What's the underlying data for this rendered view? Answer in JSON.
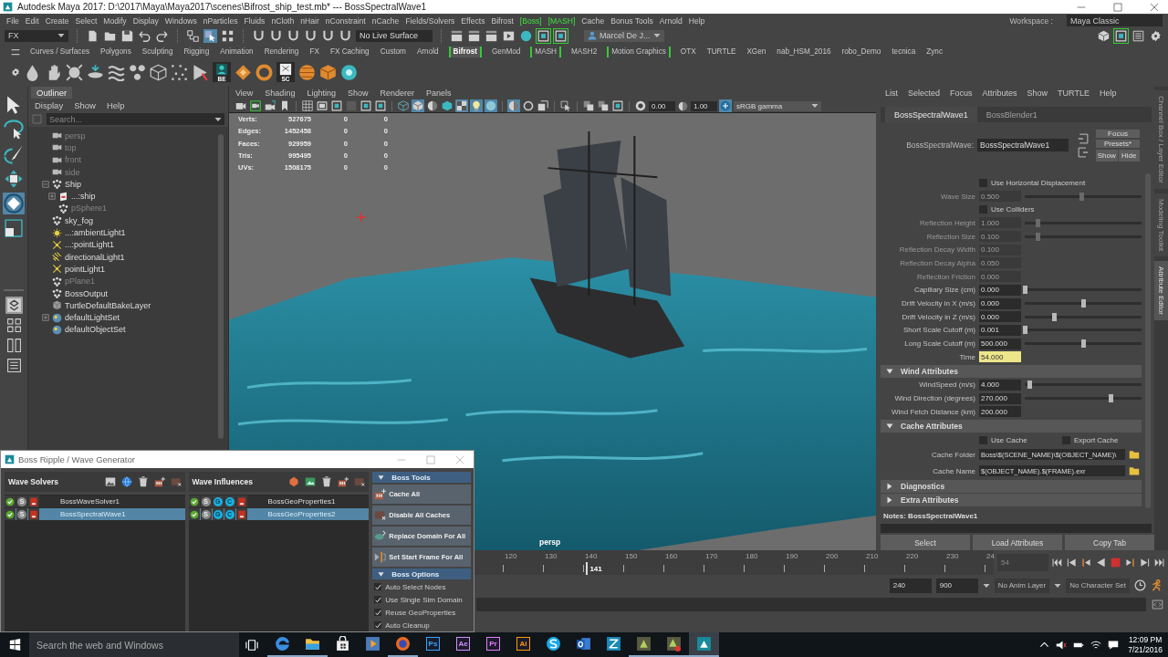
{
  "window": {
    "title": "Autodesk Maya 2017: D:\\2017\\Maya\\Maya2017\\scenes\\Bifrost_ship_test.mb* --- BossSpectralWave1"
  },
  "menu_bar": {
    "items": [
      {
        "label": "File",
        "highlighted": false
      },
      {
        "label": "Edit",
        "highlighted": false
      },
      {
        "label": "Create",
        "highlighted": false
      },
      {
        "label": "Select",
        "highlighted": false
      },
      {
        "label": "Modify",
        "highlighted": false
      },
      {
        "label": "Display",
        "highlighted": false
      },
      {
        "label": "Windows",
        "highlighted": false
      },
      {
        "label": "nParticles",
        "highlighted": false
      },
      {
        "label": "Fluids",
        "highlighted": false
      },
      {
        "label": "nCloth",
        "highlighted": false
      },
      {
        "label": "nHair",
        "highlighted": false
      },
      {
        "label": "nConstraint",
        "highlighted": false
      },
      {
        "label": "nCache",
        "highlighted": false
      },
      {
        "label": "Fields/Solvers",
        "highlighted": false
      },
      {
        "label": "Effects",
        "highlighted": false
      },
      {
        "label": "Bifrost",
        "highlighted": false
      },
      {
        "label": "[Boss]",
        "highlighted": true
      },
      {
        "label": "[MASH]",
        "highlighted": true
      },
      {
        "label": "Cache",
        "highlighted": false
      },
      {
        "label": "Bonus Tools",
        "highlighted": false
      },
      {
        "label": "Arnold",
        "highlighted": false
      },
      {
        "label": "Help",
        "highlighted": false
      }
    ],
    "workspace_label": "Workspace :",
    "workspace": "Maya Classic"
  },
  "status_line": {
    "menu_set": "FX",
    "file_tools": [
      {
        "kind": "doc",
        "on": false
      },
      {
        "kind": "folder",
        "on": false
      },
      {
        "kind": "save",
        "on": false
      },
      {
        "kind": "undo",
        "on": false
      },
      {
        "kind": "redo",
        "on": false
      }
    ],
    "select_modes": [
      {
        "kind": "select-hier",
        "on": false
      },
      {
        "kind": "select-obj",
        "on": true
      },
      {
        "kind": "select-comp",
        "on": false
      }
    ],
    "snaps": [
      {
        "kind": "magnet",
        "on": false
      },
      {
        "kind": "magnet",
        "on": false
      },
      {
        "kind": "magnet",
        "on": false
      },
      {
        "kind": "magnet",
        "on": false
      },
      {
        "kind": "magnet",
        "on": false
      },
      {
        "kind": "magnet",
        "on": false
      }
    ],
    "live_surface": "No Live Surface",
    "render_tools": [
      {
        "kind": "clapper",
        "on": false
      },
      {
        "kind": "clapper",
        "on": false
      },
      {
        "kind": "clapper",
        "on": false
      },
      {
        "kind": "render",
        "on": false
      },
      {
        "kind": "sphere-teal",
        "on": false
      },
      {
        "kind": "frame",
        "on": true
      },
      {
        "kind": "frame",
        "on": true
      }
    ],
    "user": "Marcel De J...",
    "panel_toggles": [
      {
        "kind": "cube",
        "on": false
      },
      {
        "kind": "frame",
        "on": true
      },
      {
        "kind": "layout-list",
        "on": false
      },
      {
        "kind": "gear",
        "on": false
      }
    ]
  },
  "shelf": {
    "tabs": [
      {
        "label": "Curves / Surfaces",
        "selected": false,
        "bracketed": false
      },
      {
        "label": "Polygons",
        "selected": false,
        "bracketed": false
      },
      {
        "label": "Sculpting",
        "selected": false,
        "bracketed": false
      },
      {
        "label": "Rigging",
        "selected": false,
        "bracketed": false
      },
      {
        "label": "Animation",
        "selected": false,
        "bracketed": false
      },
      {
        "label": "Rendering",
        "selected": false,
        "bracketed": false
      },
      {
        "label": "FX",
        "selected": false,
        "bracketed": false
      },
      {
        "label": "FX Caching",
        "selected": false,
        "bracketed": false
      },
      {
        "label": "Custom",
        "selected": false,
        "bracketed": false
      },
      {
        "label": "Arnold",
        "selected": false,
        "bracketed": false
      },
      {
        "label": "Bifrost",
        "selected": true,
        "bracketed": true
      },
      {
        "label": "GenMod",
        "selected": false,
        "bracketed": false
      },
      {
        "label": "MASH",
        "selected": false,
        "bracketed": true
      },
      {
        "label": "MASH2",
        "selected": false,
        "bracketed": false
      },
      {
        "label": "Motion Graphics",
        "selected": false,
        "bracketed": true
      },
      {
        "label": "OTX",
        "selected": false,
        "bracketed": false
      },
      {
        "label": "TURTLE",
        "selected": false,
        "bracketed": false
      },
      {
        "label": "XGen",
        "selected": false,
        "bracketed": false
      },
      {
        "label": "nab_HSM_2016",
        "selected": false,
        "bracketed": false
      },
      {
        "label": "robo_Demo",
        "selected": false,
        "bracketed": false
      },
      {
        "label": "tecnica",
        "selected": false,
        "bracketed": false
      },
      {
        "label": "Zync",
        "selected": false,
        "bracketed": false
      }
    ],
    "buttons": [
      {
        "kind": "droplet"
      },
      {
        "kind": "hand"
      },
      {
        "kind": "splash"
      },
      {
        "kind": "ripple"
      },
      {
        "kind": "waves"
      },
      {
        "kind": "cluster"
      },
      {
        "kind": "cube-wire"
      },
      {
        "kind": "scatter"
      },
      {
        "kind": "play-pointer"
      },
      {
        "kind": "rig-tile",
        "caption": "BE"
      },
      {
        "kind": "diamond"
      },
      {
        "kind": "orange-ring"
      },
      {
        "kind": "card",
        "caption": "SC"
      },
      {
        "kind": "striped-sphere"
      },
      {
        "kind": "orange-cube"
      },
      {
        "kind": "teal-dot"
      }
    ]
  },
  "toolbox": {
    "tools": [
      {
        "kind": "arrow",
        "selected": false
      },
      {
        "kind": "lasso",
        "selected": false
      },
      {
        "kind": "paint",
        "selected": false
      },
      {
        "kind": "move",
        "selected": false
      },
      {
        "kind": "rotate",
        "selected": true
      },
      {
        "kind": "scale",
        "selected": false
      }
    ],
    "layouts": [
      {
        "kind": "layout-single",
        "selected": true
      },
      {
        "kind": "layout-four",
        "selected": false
      },
      {
        "kind": "layout-two",
        "selected": false
      },
      {
        "kind": "layout-outliner",
        "selected": false
      }
    ]
  },
  "outliner": {
    "title": "Outliner",
    "menu": [
      "Display",
      "Show",
      "Help"
    ],
    "search_placeholder": "Search...",
    "items": [
      {
        "label": "persp",
        "kind": "camera",
        "hidden": true
      },
      {
        "label": "top",
        "kind": "camera",
        "hidden": true
      },
      {
        "label": "front",
        "kind": "camera",
        "hidden": true
      },
      {
        "label": "side",
        "kind": "camera",
        "hidden": true
      },
      {
        "label": "Ship",
        "kind": "mesh",
        "hidden": false,
        "expanded": true,
        "children": [
          {
            "label": "...:ship",
            "kind": "reference",
            "hidden": false,
            "expanded": false
          },
          {
            "label": "pSphere1",
            "kind": "mesh",
            "hidden": true
          }
        ]
      },
      {
        "label": "sky_fog",
        "kind": "mesh",
        "hidden": false
      },
      {
        "label": "...:ambientLight1",
        "kind": "ambient-light",
        "hidden": false
      },
      {
        "label": "...:pointLight1",
        "kind": "point-light",
        "hidden": false
      },
      {
        "label": "directionalLight1",
        "kind": "directional-light",
        "hidden": false
      },
      {
        "label": "pointLight1",
        "kind": "point-light",
        "hidden": false
      },
      {
        "label": "pPlane1",
        "kind": "mesh",
        "hidden": true
      },
      {
        "label": "BossOutput",
        "kind": "mesh",
        "hidden": false
      },
      {
        "label": "TurtleDefaultBakeLayer",
        "kind": "bake-layer",
        "hidden": false
      },
      {
        "label": "defaultLightSet",
        "kind": "set",
        "hidden": false,
        "expanded": false
      },
      {
        "label": "defaultObjectSet",
        "kind": "set",
        "hidden": false
      }
    ]
  },
  "viewport": {
    "menu": [
      "View",
      "Shading",
      "Lighting",
      "Show",
      "Renderer",
      "Panels"
    ],
    "toolbar": [
      {
        "kind": "camera",
        "on": false
      },
      {
        "kind": "camera-green",
        "on": false
      },
      {
        "kind": "camera-move",
        "on": false
      },
      {
        "kind": "bookmark",
        "on": false
      },
      {
        "kind": "separator"
      },
      {
        "kind": "grid",
        "on": false
      },
      {
        "kind": "film",
        "on": false
      },
      {
        "kind": "frame",
        "on": false
      },
      {
        "kind": "square",
        "on": false
      },
      {
        "kind": "frame",
        "on": false
      },
      {
        "kind": "frame",
        "on": false
      },
      {
        "kind": "separator"
      },
      {
        "kind": "cube-wire-blue",
        "on": false
      },
      {
        "kind": "cube",
        "on": true
      },
      {
        "kind": "halfmoon",
        "on": false
      },
      {
        "kind": "cube-teal",
        "on": false
      },
      {
        "kind": "checker",
        "on": true
      },
      {
        "kind": "bulb",
        "on": true
      },
      {
        "kind": "sphere",
        "on": true
      },
      {
        "kind": "separator"
      },
      {
        "kind": "shadow",
        "on": true
      },
      {
        "kind": "ring-grey",
        "on": false
      },
      {
        "kind": "cube-small",
        "on": false
      },
      {
        "kind": "separator"
      },
      {
        "kind": "pointer-box",
        "on": false
      },
      {
        "kind": "separator"
      },
      {
        "kind": "xray",
        "on": false
      },
      {
        "kind": "xray",
        "on": false
      },
      {
        "kind": "frame",
        "on": false
      },
      {
        "kind": "separator"
      },
      {
        "kind": "aperture",
        "on": false
      }
    ],
    "exposure": "0.00",
    "gamma": "1.00",
    "color_space": "sRGB gamma",
    "stats": [
      {
        "label": "Verts:",
        "values": [
          "527675",
          "0",
          "0"
        ]
      },
      {
        "label": "Edges:",
        "values": [
          "1452458",
          "0",
          "0"
        ]
      },
      {
        "label": "Faces:",
        "values": [
          "929959",
          "0",
          "0"
        ]
      },
      {
        "label": "Tris:",
        "values": [
          "995495",
          "0",
          "0"
        ]
      },
      {
        "label": "UVs:",
        "values": [
          "1508175",
          "0",
          "0"
        ]
      }
    ],
    "camera": "persp"
  },
  "attribute_editor": {
    "menu": [
      "List",
      "Selected",
      "Focus",
      "Attributes",
      "Show",
      "TURTLE",
      "Help"
    ],
    "tabs": [
      {
        "label": "BossSpectralWave1",
        "selected": true
      },
      {
        "label": "BossBlender1",
        "selected": false
      }
    ],
    "node_label": "BossSpectralWave:",
    "node_name": "BossSpectralWave1",
    "side_buttons": [
      "Focus",
      "Presets*"
    ],
    "show_hide": [
      "Show",
      "Hide"
    ],
    "rows": [
      {
        "kind": "checkbox",
        "label": "Use Horizontal Displacement",
        "checked": false
      },
      {
        "kind": "slider",
        "label": "Wave Size",
        "value": "0.500",
        "level": 0.49,
        "disabled": true,
        "keyed": false
      },
      {
        "kind": "checkbox",
        "label": "Use Colliders",
        "checked": false
      },
      {
        "kind": "slider",
        "label": "Reflection Height",
        "value": "1.000",
        "level": 0.11,
        "disabled": true,
        "keyed": false
      },
      {
        "kind": "slider",
        "label": "Reflection Size",
        "value": "0.100",
        "level": 0.11,
        "disabled": true,
        "keyed": false
      },
      {
        "kind": "field",
        "label": "Reflection Decay Width",
        "value": "0.100",
        "disabled": true,
        "keyed": false
      },
      {
        "kind": "field",
        "label": "Reflection Decay Alpha",
        "value": "0.050",
        "disabled": true,
        "keyed": false
      },
      {
        "kind": "field",
        "label": "Reflection Friction",
        "value": "0.000",
        "disabled": true,
        "keyed": false
      },
      {
        "kind": "slider",
        "label": "Capillary Size (cm)",
        "value": "0.000",
        "level": 0,
        "disabled": false,
        "keyed": false
      },
      {
        "kind": "slider",
        "label": "Drift Velocity in X (m/s)",
        "value": "0.000",
        "level": 0.5,
        "disabled": false,
        "keyed": false
      },
      {
        "kind": "slider",
        "label": "Drift Velocity in Z (m/s)",
        "value": "0.000",
        "level": 0.25,
        "disabled": false,
        "keyed": false
      },
      {
        "kind": "slider",
        "label": "Short Scale Cutoff (m)",
        "value": "0.001",
        "level": 0,
        "disabled": false,
        "keyed": false
      },
      {
        "kind": "slider",
        "label": "Long Scale Cutoff (m)",
        "value": "500.000",
        "level": 0.5,
        "disabled": false,
        "keyed": false
      },
      {
        "kind": "field",
        "label": "Time",
        "value": "54.000",
        "disabled": false,
        "keyed": true
      },
      {
        "kind": "section",
        "label": "Wind Attributes",
        "expanded": true
      },
      {
        "kind": "slider",
        "label": "WindSpeed (m/s)",
        "value": "4.000",
        "level": 0.04,
        "disabled": false,
        "keyed": false
      },
      {
        "kind": "slider",
        "label": "Wind Direction (degrees)",
        "value": "270.000",
        "level": 0.74,
        "disabled": false,
        "keyed": false
      },
      {
        "kind": "field",
        "label": "Wind Fetch Distance (km)",
        "value": "200.000",
        "disabled": false,
        "keyed": false
      },
      {
        "kind": "section",
        "label": "Cache Attributes",
        "expanded": true
      },
      {
        "kind": "checkbox-pair",
        "items": [
          {
            "label": "Use Cache",
            "checked": false
          },
          {
            "label": "Export Cache",
            "checked": false
          }
        ]
      },
      {
        "kind": "path",
        "label": "Cache Folder",
        "value": "Boss\\$(SCENE_NAME)\\$(OBJECT_NAME)\\"
      },
      {
        "kind": "path",
        "label": "Cache Name",
        "value": "$(OBJECT_NAME).$(FRAME).exr"
      },
      {
        "kind": "section",
        "label": "Diagnostics",
        "expanded": false
      },
      {
        "kind": "section",
        "label": "Extra Attributes",
        "expanded": false
      }
    ],
    "notes": "Notes: BossSpectralWave1",
    "buttons": [
      "Select",
      "Load Attributes",
      "Copy Tab"
    ]
  },
  "side_tabs": [
    {
      "label": "Channel Box / Layer Editor",
      "selected": false
    },
    {
      "label": "Modeling Toolkit",
      "selected": false
    },
    {
      "label": "Attribute Editor",
      "selected": true
    }
  ],
  "timeline": {
    "ticks": [
      "120",
      "130",
      "140",
      "150",
      "160",
      "170",
      "180",
      "190",
      "200",
      "210",
      "220",
      "230",
      "24"
    ],
    "playhead": {
      "label": "141",
      "level": 0.175
    },
    "current_time": "54"
  },
  "range_bar": {
    "playback_end": "240",
    "animation_end": "900",
    "anim_layer": "No Anim Layer",
    "character_set": "No Character Set"
  },
  "boss_window": {
    "title": "Boss Ripple / Wave Generator",
    "solvers": {
      "title": "Wave Solvers",
      "rows": [
        {
          "name": "BossWaveSolver1",
          "selected": false,
          "enabled": true,
          "badges": [
            {
              "label": "S",
              "active": false
            }
          ]
        },
        {
          "name": "BossSpectralWave1",
          "selected": true,
          "enabled": true,
          "badges": [
            {
              "label": "S",
              "active": false
            }
          ]
        }
      ]
    },
    "influences": {
      "title": "Wave Influences",
      "rows": [
        {
          "name": "BossGeoProperties1",
          "selected": false,
          "enabled": true,
          "badges": [
            {
              "label": "S",
              "active": false
            },
            {
              "label": "G",
              "active": true
            },
            {
              "label": "C",
              "active": true
            }
          ]
        },
        {
          "name": "BossGeoProperties2",
          "selected": true,
          "enabled": true,
          "badges": [
            {
              "label": "S",
              "active": false
            },
            {
              "label": "G",
              "active": true
            },
            {
              "label": "C",
              "active": true
            }
          ]
        }
      ]
    },
    "tools": {
      "title": "Boss Tools",
      "expanded": true,
      "buttons": [
        {
          "label": "Cache All",
          "kind": "cache-add"
        },
        {
          "label": "Disable All Caches",
          "kind": "cache-remove"
        },
        {
          "label": "Replace Domain For All",
          "kind": "replace-domain"
        },
        {
          "label": "Set Start Frame For All",
          "kind": "start-frame"
        }
      ]
    },
    "options": {
      "title": "Boss Options",
      "expanded": true,
      "items": [
        {
          "label": "Auto Select Nodes",
          "checked": true
        },
        {
          "label": "Use Single Sim Domain",
          "checked": true
        },
        {
          "label": "Reuse GeoProperties",
          "checked": true
        },
        {
          "label": "Auto Cleanup",
          "checked": true
        }
      ]
    }
  },
  "taskbar": {
    "search_placeholder": "Search the web and Windows",
    "apps": [
      {
        "kind": "edge",
        "running": true,
        "active": false
      },
      {
        "kind": "explorer",
        "running": true,
        "active": false
      },
      {
        "kind": "store",
        "running": false,
        "active": false
      },
      {
        "kind": "media",
        "running": false,
        "active": false
      },
      {
        "kind": "firefox",
        "running": true,
        "active": false
      },
      {
        "kind": "letter",
        "label": "Ps",
        "color": "#31a8ff",
        "running": false,
        "active": false
      },
      {
        "kind": "letter",
        "label": "Ae",
        "color": "#d291ff",
        "running": false,
        "active": false
      },
      {
        "kind": "letter",
        "label": "Pr",
        "color": "#e77cff",
        "running": false,
        "active": false
      },
      {
        "kind": "letter",
        "label": "Ai",
        "color": "#ff9a00",
        "running": false,
        "active": false
      },
      {
        "kind": "skype",
        "running": false,
        "active": false
      },
      {
        "kind": "mail",
        "running": false,
        "active": false
      },
      {
        "kind": "z-tile",
        "running": false,
        "active": false
      },
      {
        "kind": "green-tile",
        "running": true,
        "active": false
      },
      {
        "kind": "green-tile-badge",
        "running": true,
        "active": false
      },
      {
        "kind": "maya-tile",
        "running": true,
        "active": true
      }
    ],
    "time": "12:09 PM",
    "date": "7/21/2016"
  }
}
